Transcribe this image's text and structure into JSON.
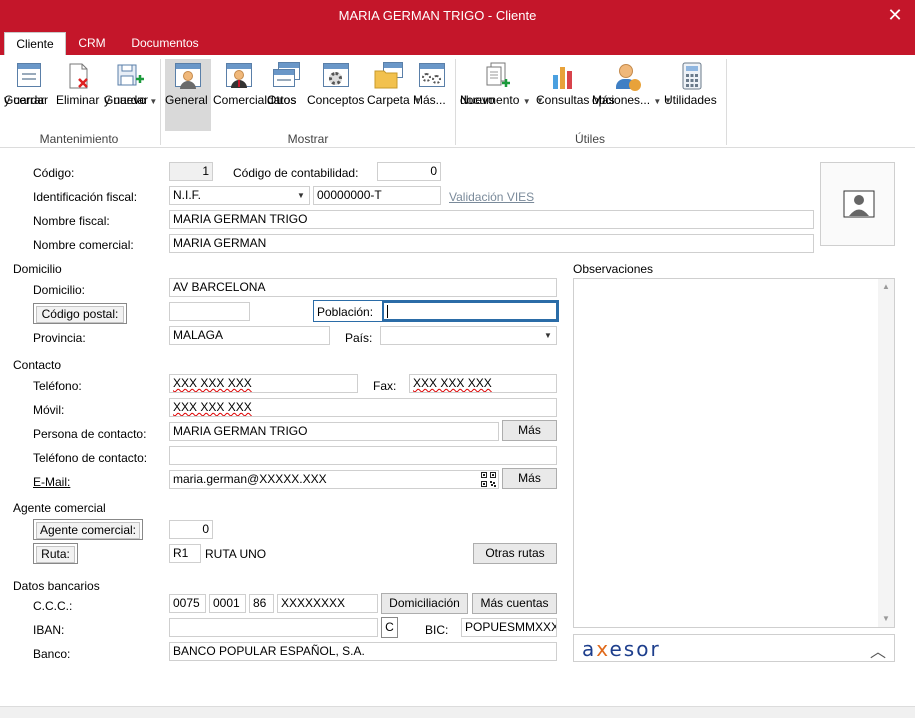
{
  "window": {
    "title": "MARIA GERMAN TRIGO - Cliente"
  },
  "tabs": [
    {
      "label": "Cliente"
    },
    {
      "label": "CRM"
    },
    {
      "label": "Documentos"
    }
  ],
  "ribbon": {
    "mantenimiento": {
      "label": "Mantenimiento",
      "guardar_cerrar": [
        "Guardar",
        "y cerrar"
      ],
      "eliminar": "Eliminar",
      "guardar_nuevo": [
        "Guardar",
        "y nuevo"
      ]
    },
    "mostrar": {
      "label": "Mostrar",
      "general": "General",
      "comercial": "Comercial",
      "otros_datos": [
        "Otros",
        "datos"
      ],
      "conceptos": "Conceptos",
      "carpeta": "Carpeta",
      "mas": "Más..."
    },
    "utiles": {
      "label": "Útiles",
      "nuevo_documento": [
        "Nuevo",
        "documento"
      ],
      "consultas": "Consultas",
      "mas_opciones": [
        "Más",
        "opciones..."
      ],
      "utilidades": "Utilidades"
    }
  },
  "form": {
    "codigo": {
      "label": "Código:",
      "value": "1"
    },
    "codigo_contab": {
      "label": "Código de contabilidad:",
      "value": "0"
    },
    "ident_fiscal": {
      "label": "Identificación fiscal:",
      "type": "N.I.F.",
      "value": "00000000-T"
    },
    "validacion_vies": "Validación VIES",
    "nombre_fiscal": {
      "label": "Nombre fiscal:",
      "value": "MARIA GERMAN TRIGO"
    },
    "nombre_comercial": {
      "label": "Nombre comercial:",
      "value": "MARIA GERMAN"
    },
    "domicilio_section": "Domicilio",
    "domicilio": {
      "label": "Domicilio:",
      "value": "AV BARCELONA"
    },
    "codigo_postal": {
      "label": "Código postal:",
      "value": ""
    },
    "poblacion": {
      "label": "Población:",
      "value": ""
    },
    "provincia": {
      "label": "Provincia:",
      "value": "MALAGA"
    },
    "pais": {
      "label": "País:",
      "value": ""
    },
    "contacto_section": "Contacto",
    "telefono": {
      "label": "Teléfono:",
      "value": "XXX XXX XXX"
    },
    "fax": {
      "label": "Fax:",
      "value": "XXX XXX XXX"
    },
    "movil": {
      "label": "Móvil:",
      "value": "XXX XXX XXX"
    },
    "persona_contacto": {
      "label": "Persona de contacto:",
      "value": "MARIA GERMAN TRIGO",
      "button": "Más"
    },
    "telefono_contacto": {
      "label": "Teléfono de contacto:",
      "value": ""
    },
    "email": {
      "label": "E-Mail:",
      "value": "maria.german@XXXXX.XXX",
      "button": "Más"
    },
    "agente_section": "Agente comercial",
    "agente": {
      "label": "Agente comercial:",
      "value": "0"
    },
    "ruta": {
      "label": "Ruta:",
      "code": "R1",
      "name": "RUTA UNO",
      "button": "Otras rutas"
    },
    "bancos_section": "Datos bancarios",
    "ccc": {
      "label": "C.C.C.:",
      "p1": "0075",
      "p2": "0001",
      "p3": "86",
      "p4": "XXXXXXXX",
      "btn_domic": "Domiciliación",
      "btn_cuentas": "Más cuentas"
    },
    "iban": {
      "label": "IBAN:",
      "value": "",
      "btn": "C"
    },
    "bic": {
      "label": "BIC:",
      "value": "POPUESMMXXX"
    },
    "banco": {
      "label": "Banco:",
      "value": "BANCO POPULAR ESPAÑOL, S.A."
    },
    "observaciones": {
      "label": "Observaciones",
      "value": ""
    }
  },
  "axesor": {
    "logo_a": "a",
    "logo_x": "x",
    "logo_rest": "esor"
  }
}
